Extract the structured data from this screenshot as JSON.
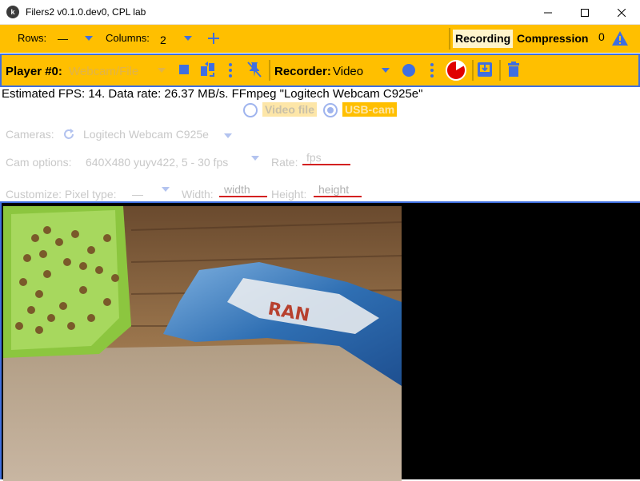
{
  "window": {
    "title": "Filers2 v0.1.0.dev0, CPL lab",
    "app_icon": "kivy-icon"
  },
  "toolbar1": {
    "rows_label": "Rows:",
    "rows_value": "—",
    "columns_label": "Columns:",
    "columns_value": "2",
    "add_icon": "plus-icon",
    "recording_label": "Recording",
    "compression_label": "Compression",
    "warning_count": "0"
  },
  "toolbar2": {
    "player_label": "Player #0:",
    "source_placeholder": "Webcam/File",
    "recorder_label": "Recorder:",
    "recorder_value": "Video"
  },
  "status": {
    "text": "Estimated FPS: 14. Data rate: 26.37 MB/s. FFmpeg \"Logitech Webcam C925e\""
  },
  "settings": {
    "video_file_label": "Video file",
    "usb_cam_label": "USB-cam",
    "selected_source": "USB-cam",
    "cameras_label": "Cameras:",
    "camera_value": "Logitech Webcam C925e",
    "cam_options_label": "Cam options:",
    "cam_options_value": "640X480 yuyv422, 5 - 30 fps",
    "rate_label": "Rate:",
    "rate_placeholder": "fps",
    "customize_label": "Customize: Pixel type:",
    "pixel_type_value": "—",
    "width_label": "Width:",
    "width_placeholder": "width",
    "height_label": "Height:",
    "height_placeholder": "height"
  },
  "colors": {
    "accent_yellow": "#ffbf00",
    "accent_blue": "#3f6fe0",
    "error_red": "#d32020"
  }
}
